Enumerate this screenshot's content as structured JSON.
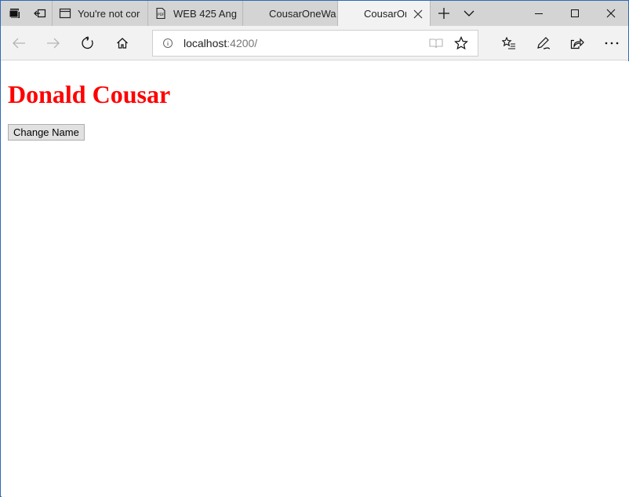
{
  "tabs": [
    {
      "title": "You're not cor",
      "icon": "page-icon"
    },
    {
      "title": "WEB 425 Ang",
      "icon": "pdf-icon"
    },
    {
      "title": "CousarOneWa",
      "icon": "none"
    },
    {
      "title": "CousarOn",
      "icon": "none",
      "active": true
    }
  ],
  "address": {
    "host": "localhost",
    "port": ":4200/"
  },
  "page": {
    "name": "Donald Cousar",
    "button_label": "Change Name",
    "name_color": "#ff0000"
  }
}
